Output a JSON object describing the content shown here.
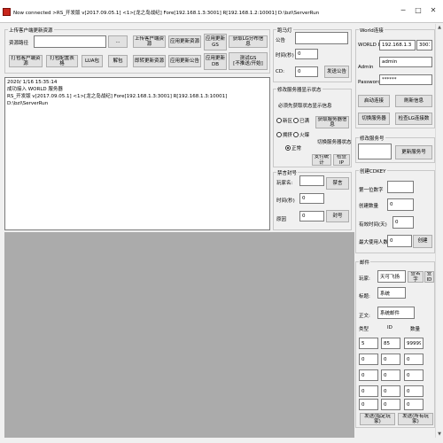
{
  "window": {
    "title": "Now connected >RS_开发版 v[2017.09.05.1] <1>[龙之岛战纪] Fore[192.168.1.3:3001] R[192.168.1.2:10001] D:\\bzl\\ServerRun",
    "minimize": "─",
    "maximize": "□",
    "close": "✕"
  },
  "upload": {
    "title": "上传客户端更新资源",
    "path_label": "资源路径",
    "path_value": "",
    "browse": "...",
    "upload_local": "上传客户端资源",
    "apply_update": "应用更新资源",
    "update_gs": "应用更新\nGS",
    "get_lg": "获取LG分布信息",
    "pack_local": "打包客户端资源",
    "pack_table": "打包配置表格",
    "lua": "LUA包",
    "unpack": "解包",
    "sync_update": "即转更新资源",
    "apply_notice": "应用更新公告",
    "update_db": "应用更新\nDB",
    "test_gs": "测试GS\n[不推送/开始]"
  },
  "log": {
    "lines": [
      "2020/ 1/16 15:35:14",
      "成功接入 WORLD 服务器",
      "RS_开发版 v[2017.09.05.1] <1>[龙之岛战纪] Fore[192.168.1.3:3001] R[192.168.1.3:10001] D:\\bzl\\ServerRun"
    ]
  },
  "marquee": {
    "title": "跑马灯",
    "notice_label": "公告",
    "notice_value": "",
    "time_label": "时间(秒)",
    "time_value": "0",
    "cd_label": "CD:",
    "cd_value": "0",
    "send": "发送公告"
  },
  "status": {
    "title": "修改服务器显示状态",
    "hint": "必须先获取状态显示信息",
    "get_info": "获取服务器信息",
    "radio_new": "新区",
    "radio_full": "已满",
    "radio_busy": "拥挤",
    "radio_hot": "火爆",
    "radio_normal": "正常",
    "change_label": "切换服务器状态",
    "support": "支付统计",
    "check_ip": "检查IP"
  },
  "ban": {
    "title": "禁言封号",
    "player_label": "玩家名:",
    "player_value": "",
    "mute": "禁言",
    "time_label": "时间(秒)",
    "time_value": "0",
    "reason_label": "原因",
    "reason_value": "0",
    "ban": "封号"
  },
  "world": {
    "title": "World连接",
    "ip_label": "WORLD IP",
    "ip_value": "192.168.1.3",
    "port_value": "3001",
    "admin_label": "Admin",
    "admin_value": "admin",
    "password_label": "Password",
    "password_value": "******",
    "start_connect": "启动连接",
    "refresh": "刷新信息",
    "switch_server": "切换服务器",
    "check_lg": "检查LG连接数"
  },
  "serverno": {
    "title": "修改服务号",
    "value": "",
    "update": "更新服务号"
  },
  "cdkey": {
    "title": "创建CDKEY",
    "first_number_label": "第一位数字",
    "first_number_value": "",
    "create_count_label": "创建数量",
    "create_count_value": "0",
    "valid_time_label": "有效时间(天)",
    "valid_time_value": "0",
    "max_users_label": "最大使用人数",
    "max_users_value": "0",
    "create": "创建"
  },
  "mail": {
    "title": "邮件",
    "player_label": "玩家:",
    "player_value": "天可飞扬",
    "query_player": "查名字",
    "query_id": "查ID",
    "title_label": "标题:",
    "title_value": "系统",
    "body_label": "正文:",
    "body_value": "系统邮件",
    "col_type": "类型",
    "col_id": "ID",
    "col_count": "数量",
    "rows": [
      {
        "type": "5",
        "id": "85",
        "count": "99999"
      },
      {
        "type": "0",
        "id": "0",
        "count": "0"
      },
      {
        "type": "0",
        "id": "0",
        "count": "0"
      },
      {
        "type": "0",
        "id": "0",
        "count": "0"
      },
      {
        "type": "0",
        "id": "0",
        "count": "0"
      }
    ],
    "send_one": "发送(指定玩家)",
    "send_all": "发送(所有玩家)"
  }
}
